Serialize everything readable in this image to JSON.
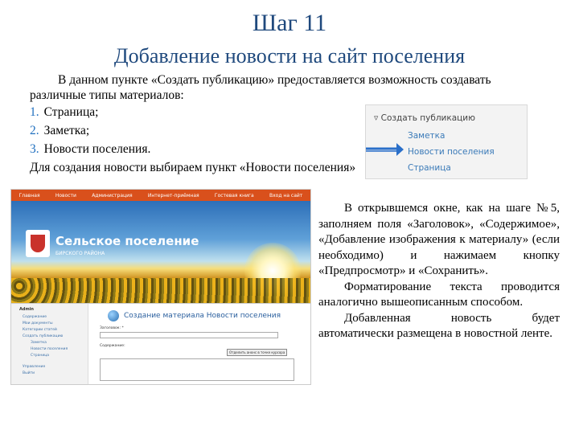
{
  "title": "Шаг 11",
  "subtitle": "Добавление новости на сайт поселения",
  "intro": {
    "line1": "В данном пункте «Создать публикацию» предоставляется возможность создавать",
    "line2": "различные типы материалов:"
  },
  "list": [
    {
      "num": "1.",
      "text": "Страница;"
    },
    {
      "num": "2.",
      "text": "Заметка;"
    },
    {
      "num": "3.",
      "text": "Новости поселения."
    }
  ],
  "outro": "Для создания новости выбираем пункт «Новости поселения»",
  "menu": {
    "header": "Создать публикацию",
    "items": [
      "Заметка",
      "Новости поселения",
      "Страница"
    ]
  },
  "site": {
    "nav": [
      "Главная",
      "Новости",
      "Администрация",
      "Интернет-приёмная",
      "Гостевая книга",
      "Вход на сайт"
    ],
    "title": "Сельское поселение",
    "subtitle": "БИРСКОГО РАЙОНА"
  },
  "admin": {
    "block_title": "Admin",
    "side_items": [
      "Содержание",
      "Мои документы",
      "Категории статей",
      "Создать публикацию",
      "Заметка",
      "Новости поселения",
      "Страница",
      "Управление",
      "Выйти"
    ],
    "heading": "Создание материала Новости поселения",
    "label_title": "Заголовок: *",
    "label_content": "Содержание:",
    "btn": "Отделить анонс в точке курсора"
  },
  "right_paragraphs": [
    "В открывшемся окне, как на шаге №5, заполняем поля «Заголовок», «Содержимое», «Добавление изображения к материалу» (если необходимо) и нажимаем кнопку «Предпросмотр» и «Сохранить».",
    "Форматирование текста проводится аналогично вышеописанным способом.",
    "Добавленная новость будет автоматически размещена в новостной ленте."
  ],
  "colors": {
    "heading": "#1f497d",
    "accent": "#1f6fbf",
    "nav": "#d9501c"
  }
}
